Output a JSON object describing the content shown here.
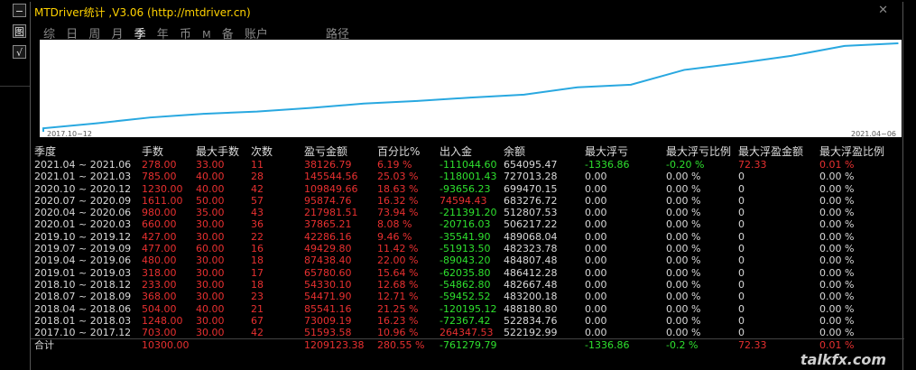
{
  "app": {
    "title": "MTDriver统计 ,V3.06 (http://mtdriver.cn)",
    "close_icon": "✕",
    "left_buttons": [
      "−",
      "图",
      "√"
    ],
    "watermark": "talkfx.com"
  },
  "tabs": [
    {
      "label": "综",
      "active": false
    },
    {
      "label": "日",
      "active": false
    },
    {
      "label": "周",
      "active": false
    },
    {
      "label": "月",
      "active": false
    },
    {
      "label": "季",
      "active": true
    },
    {
      "label": "年",
      "active": false
    },
    {
      "label": "币",
      "active": false
    },
    {
      "label": "M",
      "active": false,
      "small": true
    },
    {
      "label": "备",
      "active": false
    },
    {
      "label": "账户",
      "active": false
    },
    {
      "label": "路径",
      "active": false
    }
  ],
  "chart_data": {
    "type": "line",
    "x_start_label": "2017.10~12",
    "x_end_label": "2021.04~06",
    "series": [
      {
        "color": "#29a8e0",
        "values": [
          51593.58,
          124803.67,
          209277.3,
          263822.34,
          296223.04,
          348883.0,
          413686.11,
          451124.86,
          502068.14,
          544284.32,
          651815.51,
          689681.16,
          907662.67,
          1003537.41,
          1113387.07,
          1258931.61,
          1297058.37
        ]
      }
    ]
  },
  "table": {
    "headers": [
      "季度",
      "手数",
      "最大手数",
      "次数",
      "盈亏金额",
      "百分比%",
      "出入金",
      "余额",
      "最大浮亏",
      "最大浮亏比例",
      "最大浮盈金额",
      "最大浮盈比例"
    ],
    "rows": [
      [
        "2021.04 ~ 2021.06",
        "278.00",
        "33.00",
        "11",
        "38126.79",
        "6.19 %",
        "-111044.60",
        "654095.47",
        "-1336.86",
        "-0.20 %",
        "72.33",
        "0.01 %"
      ],
      [
        "2021.01 ~ 2021.03",
        "785.00",
        "40.00",
        "28",
        "145544.56",
        "25.03 %",
        "-118001.43",
        "727013.28",
        "0.00",
        "0.00 %",
        "0",
        "0.00 %"
      ],
      [
        "2020.10 ~ 2020.12",
        "1230.00",
        "40.00",
        "42",
        "109849.66",
        "18.63 %",
        "-93656.23",
        "699470.15",
        "0.00",
        "0.00 %",
        "0",
        "0.00 %"
      ],
      [
        "2020.07 ~ 2020.09",
        "1611.00",
        "50.00",
        "57",
        "95874.76",
        "16.32 %",
        "74594.43",
        "683276.72",
        "0.00",
        "0.00 %",
        "0",
        "0.00 %"
      ],
      [
        "2020.04 ~ 2020.06",
        "980.00",
        "35.00",
        "43",
        "217981.51",
        "73.94 %",
        "-211391.20",
        "512807.53",
        "0.00",
        "0.00 %",
        "0",
        "0.00 %"
      ],
      [
        "2020.01 ~ 2020.03",
        "660.00",
        "30.00",
        "36",
        "37865.21",
        "8.08 %",
        "-20716.03",
        "506217.22",
        "0.00",
        "0.00 %",
        "0",
        "0.00 %"
      ],
      [
        "2019.10 ~ 2019.12",
        "427.00",
        "30.00",
        "22",
        "42286.16",
        "9.46 %",
        "-35541.90",
        "489068.04",
        "0.00",
        "0.00 %",
        "0",
        "0.00 %"
      ],
      [
        "2019.07 ~ 2019.09",
        "477.00",
        "60.00",
        "16",
        "49429.80",
        "11.42 %",
        "-51913.50",
        "482323.78",
        "0.00",
        "0.00 %",
        "0",
        "0.00 %"
      ],
      [
        "2019.04 ~ 2019.06",
        "480.00",
        "30.00",
        "18",
        "87438.40",
        "22.00 %",
        "-89043.20",
        "484807.48",
        "0.00",
        "0.00 %",
        "0",
        "0.00 %"
      ],
      [
        "2019.01 ~ 2019.03",
        "318.00",
        "30.00",
        "17",
        "65780.60",
        "15.64 %",
        "-62035.80",
        "486412.28",
        "0.00",
        "0.00 %",
        "0",
        "0.00 %"
      ],
      [
        "2018.10 ~ 2018.12",
        "233.00",
        "30.00",
        "18",
        "54330.10",
        "12.68 %",
        "-54862.80",
        "482667.48",
        "0.00",
        "0.00 %",
        "0",
        "0.00 %"
      ],
      [
        "2018.07 ~ 2018.09",
        "368.00",
        "30.00",
        "23",
        "54471.90",
        "12.71 %",
        "-59452.52",
        "483200.18",
        "0.00",
        "0.00 %",
        "0",
        "0.00 %"
      ],
      [
        "2018.04 ~ 2018.06",
        "504.00",
        "40.00",
        "21",
        "85541.16",
        "21.25 %",
        "-120195.12",
        "488180.80",
        "0.00",
        "0.00 %",
        "0",
        "0.00 %"
      ],
      [
        "2018.01 ~ 2018.03",
        "1248.00",
        "30.00",
        "67",
        "73009.19",
        "16.23 %",
        "-72367.42",
        "522834.76",
        "0.00",
        "0.00 %",
        "0",
        "0.00 %"
      ],
      [
        "2017.10 ~ 2017.12",
        "703.00",
        "30.00",
        "42",
        "51593.58",
        "10.96 %",
        "264347.53",
        "522192.99",
        "0.00",
        "0.00 %",
        "0",
        "0.00 %"
      ]
    ],
    "total": [
      "合计",
      "10300.00",
      "",
      "",
      "1209123.38",
      "280.55 %",
      "-761279.79",
      "",
      "-1336.86",
      "-0.2 %",
      "72.33",
      "0.01 %"
    ]
  },
  "colors": {
    "profit": "#e83030",
    "positive": "#2ee02e",
    "neutral": "#d8d8d8",
    "title": "#ffd200",
    "line": "#29a8e0"
  }
}
